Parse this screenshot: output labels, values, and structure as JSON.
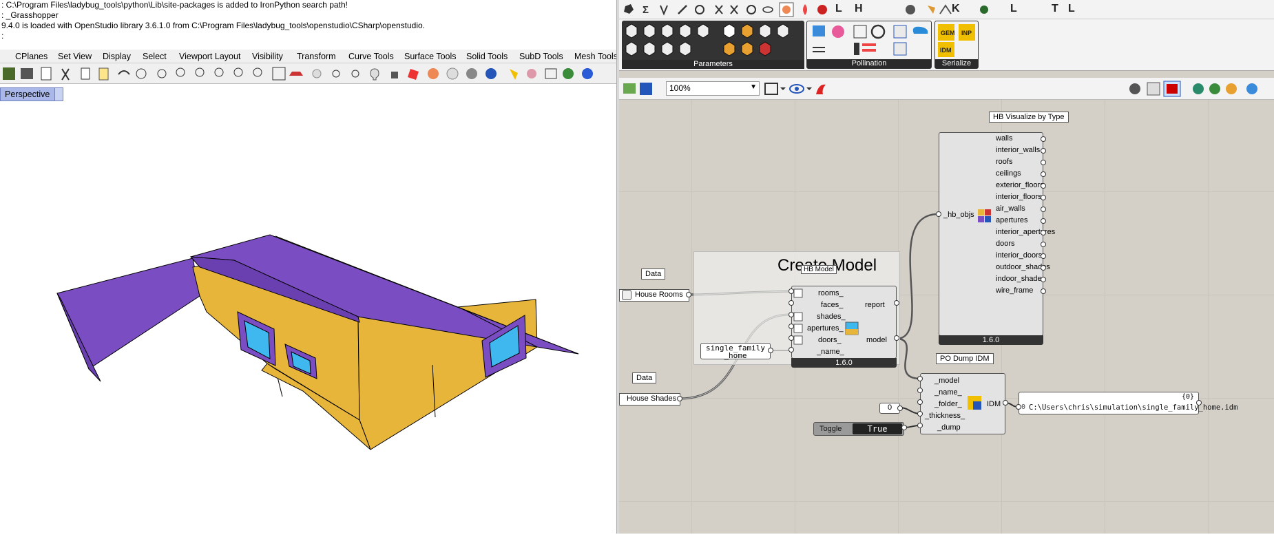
{
  "command_history": [
    ": C:\\Program Files\\ladybug_tools\\python\\Lib\\site-packages is added to IronPython search path!",
    ": _Grasshopper",
    "9.4.0 is loaded with OpenStudio library 3.6.1.0 from C:\\Program Files\\ladybug_tools\\openstudio\\CSharp\\openstudio.",
    ":"
  ],
  "rhino_menu": [
    "CPlanes",
    "Set View",
    "Display",
    "Select",
    "Viewport Layout",
    "Visibility",
    "Transform",
    "Curve Tools",
    "Surface Tools",
    "Solid Tools",
    "SubD Tools",
    "Mesh Tools"
  ],
  "viewport": {
    "label": "Perspective"
  },
  "colors": {
    "roof": "#7a4ec2",
    "wall": "#e8b53b",
    "window": "#3fb8ef",
    "window_frame": "#7a4ec2",
    "canvas_bg": "#d4d0c8"
  },
  "gh_tabs": [
    "L",
    "H",
    "K",
    "L",
    "T",
    "L"
  ],
  "ribbon_groups": {
    "parameters": "Parameters",
    "pollination": "Pollination",
    "serialize": "Serialize"
  },
  "ribbon_icons": {
    "gem": "GEM",
    "inp": "INP",
    "idm": "IDM"
  },
  "gh_toolbar": {
    "zoom": "100%"
  },
  "group": {
    "title": "Create Model"
  },
  "components": {
    "hb_model": {
      "title": "HB Model",
      "inputs": [
        "rooms_",
        "faces_",
        "shades_",
        "apertures_",
        "doors_",
        "_name_"
      ],
      "outputs": [
        "report",
        "model"
      ],
      "version": "1.6.0"
    },
    "hb_visualize": {
      "title": "HB Visualize by Type",
      "input": "_hb_objs",
      "outputs": [
        "walls",
        "interior_walls",
        "roofs",
        "ceilings",
        "exterior_floors",
        "interior_floors",
        "air_walls",
        "apertures",
        "interior_apertures",
        "doors",
        "interior_doors",
        "outdoor_shades",
        "indoor_shades",
        "wire_frame"
      ],
      "version": "1.6.0"
    },
    "po_dump_idm": {
      "title": "PO Dump IDM",
      "inputs": [
        "_model",
        "_name_",
        "_folder_",
        "_thickness_",
        "_dump"
      ],
      "output": "IDM"
    }
  },
  "params": {
    "house_rooms": {
      "tag": "Data",
      "label": "House Rooms"
    },
    "house_shades": {
      "tag": "Data",
      "label": "House Shades"
    },
    "name_panel": {
      "line1": "single_family",
      "line2": "_home"
    },
    "number": {
      "value": "0"
    },
    "toggle": {
      "label": "Toggle",
      "value": "True"
    }
  },
  "output_panel": {
    "header": "{0}",
    "index": "0",
    "path": "C:\\Users\\chris\\simulation\\single_family_home.idm"
  }
}
